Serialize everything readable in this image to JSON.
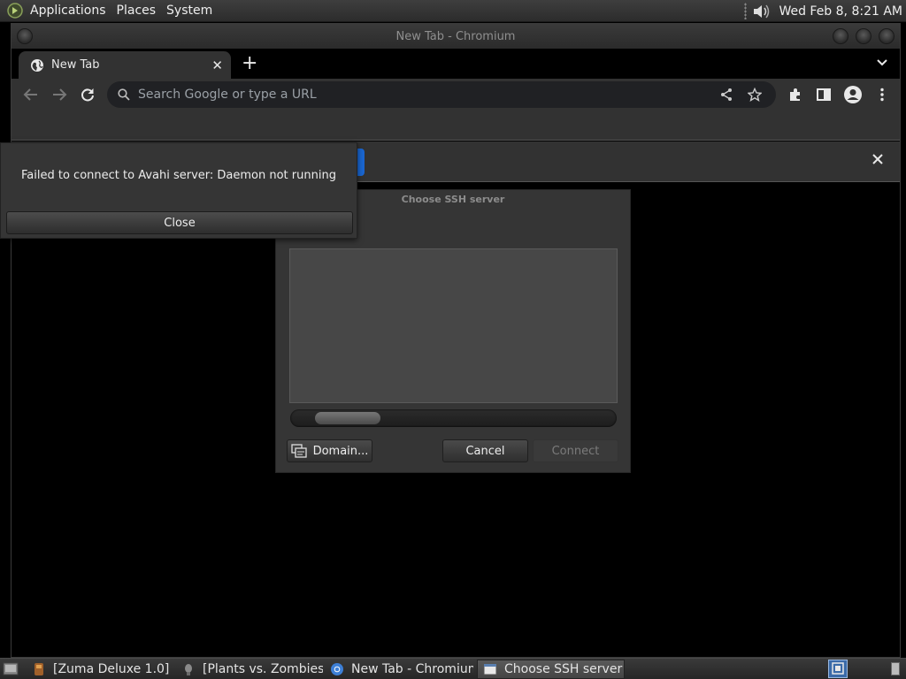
{
  "top_panel": {
    "menus": [
      "Applications",
      "Places",
      "System"
    ],
    "clock": "Wed Feb  8,  8:21 AM"
  },
  "browser": {
    "window_title": "New Tab - Chromium",
    "tab_title": "New Tab",
    "omnibox_placeholder": "Search Google or type a URL"
  },
  "avahi_dialog": {
    "message": "Failed to connect to Avahi server: Daemon not running",
    "close_label": "Close"
  },
  "ssh_dialog": {
    "title": "Choose SSH server",
    "domain_label": "Domain...",
    "cancel_label": "Cancel",
    "connect_label": "Connect"
  },
  "taskbar": {
    "items": [
      {
        "label": "[Zuma Deluxe 1.0]",
        "icon": "zuma-icon"
      },
      {
        "label": "[Plants vs. Zombies]",
        "icon": "plants-vs-zombies-icon"
      },
      {
        "label": "New Tab - Chromium",
        "icon": "chromium-icon"
      },
      {
        "label": "Choose SSH server",
        "icon": "window-icon",
        "active": true
      }
    ]
  },
  "colors": {
    "panel": "#2c2c2c",
    "chrome_toolbar": "#323232",
    "omnibox": "#202124",
    "dialog": "#353535",
    "infobar_accent": "#1a66d0"
  }
}
